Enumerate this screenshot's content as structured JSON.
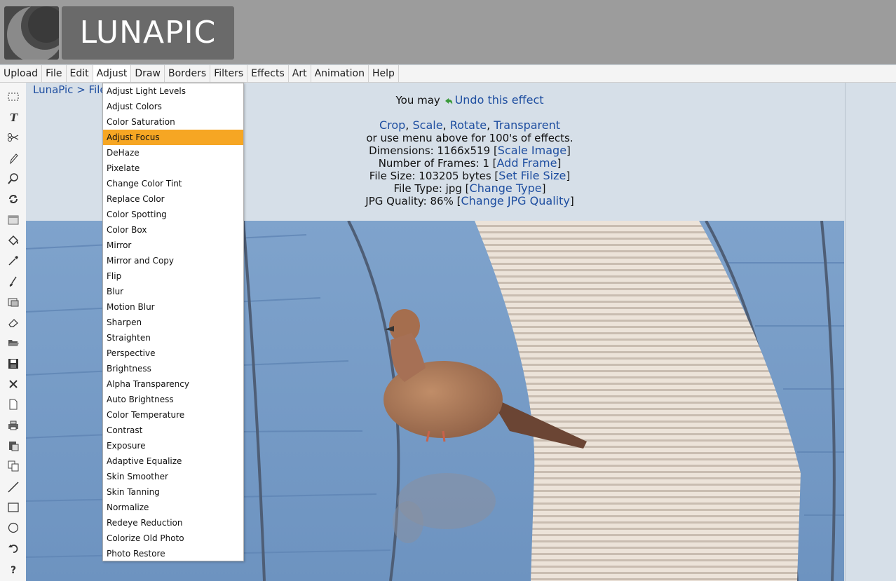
{
  "header": {
    "logo_text": "LUNAPIC"
  },
  "menubar": {
    "items": [
      "Upload",
      "File",
      "Edit",
      "Adjust",
      "Draw",
      "Borders",
      "Filters",
      "Effects",
      "Art",
      "Animation",
      "Help"
    ],
    "open_menu": "Adjust"
  },
  "breadcrumb": "LunaPic > File",
  "info": {
    "undo_prefix": "You may",
    "undo_link": "Undo this effect",
    "crop": "Crop",
    "scale": "Scale",
    "rotate": "Rotate",
    "transparent": "Transparent",
    "sep": ",",
    "menu_hint": "or use menu above for 100's of effects.",
    "dimensions_label": "Dimensions: 1166x519",
    "dimensions_link": "Scale Image",
    "frames_label": "Number of Frames: 1",
    "frames_link": "Add Frame",
    "filesize_label": "File Size: 103205 bytes",
    "filesize_link": "Set File Size",
    "filetype_label": "File Type: jpg",
    "filetype_link": "Change Type",
    "quality_label": "JPG Quality: 86%",
    "quality_link": "Change JPG Quality",
    "lb": "[",
    "rb": "]"
  },
  "dropdown": {
    "active": "Adjust Focus",
    "items": [
      "Adjust Light Levels",
      "Adjust Colors",
      "Color Saturation",
      "Adjust Focus",
      "DeHaze",
      "Pixelate",
      "Change Color Tint",
      "Replace Color",
      "Color Spotting",
      "Color Box",
      "Mirror",
      "Mirror and Copy",
      "Flip",
      "Blur",
      "Motion Blur",
      "Sharpen",
      "Straighten",
      "Perspective",
      "Brightness",
      "Alpha Transparency",
      "Auto Brightness",
      "Color Temperature",
      "Contrast",
      "Exposure",
      "Adaptive Equalize",
      "Skin Smoother",
      "Skin Tanning",
      "Normalize",
      "Redeye Reduction",
      "Colorize Old Photo",
      "Photo Restore"
    ]
  },
  "toolbar": {
    "tools": [
      "select-rect-icon",
      "text-icon",
      "scissors-icon",
      "pencil-icon",
      "zoom-icon",
      "rotate-icon",
      "layer-icon",
      "fill-bucket-icon",
      "eyedropper-icon",
      "brush-icon",
      "crop-image-icon",
      "eraser-icon",
      "open-folder-icon",
      "save-icon",
      "close-icon",
      "new-file-icon",
      "print-icon",
      "paste-icon",
      "copy-icon",
      "line-icon",
      "rectangle-icon",
      "circle-icon",
      "undo-icon",
      "help-icon"
    ]
  },
  "colors": {
    "header_bg": "#9c9c9c",
    "link": "#1e4ea0",
    "highlight": "#f6a623",
    "content_bg": "#d6dfe8"
  }
}
